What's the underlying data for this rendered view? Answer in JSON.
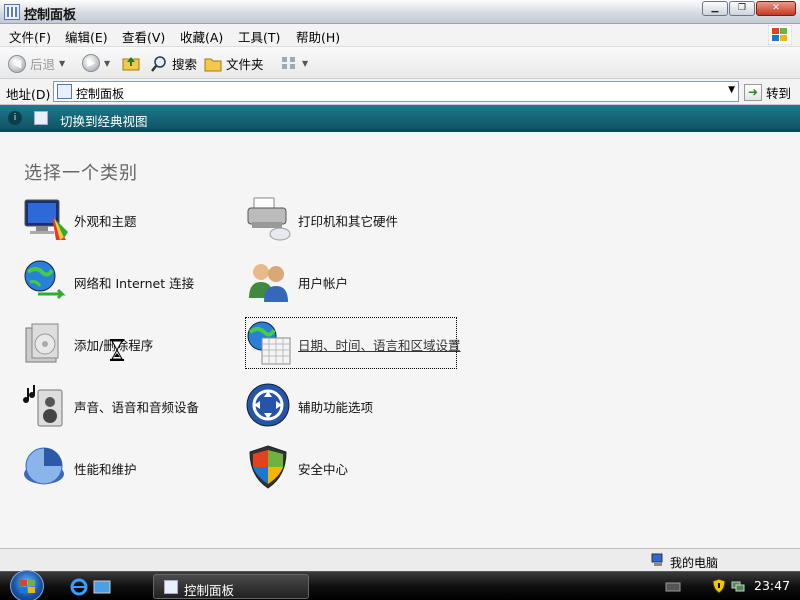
{
  "window": {
    "title": "控制面板"
  },
  "menu": [
    "文件(F)",
    "编辑(E)",
    "查看(V)",
    "收藏(A)",
    "工具(T)",
    "帮助(H)"
  ],
  "toolbar": {
    "back": "后退",
    "search": "搜索",
    "folders": "文件夹"
  },
  "address": {
    "label": "地址(D)",
    "value": "控制面板",
    "go": "转到"
  },
  "banner": {
    "text": "切换到经典视图"
  },
  "main": {
    "heading": "选择一个类别",
    "categories": [
      {
        "label": "外观和主题",
        "icon": "appearance-themes-icon"
      },
      {
        "label": "打印机和其它硬件",
        "icon": "printer-icon"
      },
      {
        "label": "网络和 Internet 连接",
        "icon": "network-globe-icon"
      },
      {
        "label": "用户帐户",
        "icon": "users-icon"
      },
      {
        "label": "添加/删除程序",
        "icon": "add-remove-programs-icon"
      },
      {
        "label": "日期、时间、语言和区域设置",
        "icon": "date-time-globe-icon"
      },
      {
        "label": "声音、语音和音频设备",
        "icon": "speaker-icon"
      },
      {
        "label": "辅助功能选项",
        "icon": "accessibility-icon"
      },
      {
        "label": "性能和维护",
        "icon": "performance-pie-icon"
      },
      {
        "label": "安全中心",
        "icon": "security-shield-icon"
      }
    ]
  },
  "status": {
    "location": "我的电脑"
  },
  "taskbar": {
    "task": "控制面板",
    "clock": "23:47"
  }
}
